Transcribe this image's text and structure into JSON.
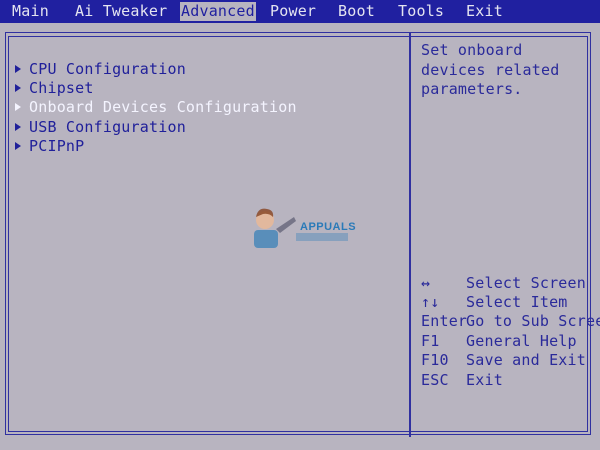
{
  "menubar": {
    "tabs": [
      {
        "label": "Main"
      },
      {
        "label": "Ai Tweaker"
      },
      {
        "label": "Advanced"
      },
      {
        "label": "Power"
      },
      {
        "label": "Boot"
      },
      {
        "label": "Tools"
      },
      {
        "label": "Exit"
      }
    ],
    "active_tab": "Advanced"
  },
  "menu_items": [
    {
      "label": "CPU Configuration"
    },
    {
      "label": "Chipset"
    },
    {
      "label": "Onboard Devices Configuration",
      "selected": true
    },
    {
      "label": "USB Configuration"
    },
    {
      "label": "PCIPnP"
    }
  ],
  "help": {
    "lines": [
      "Set onboard",
      "devices related",
      "parameters."
    ]
  },
  "keys": [
    {
      "key": "↔",
      "desc": "Select Screen"
    },
    {
      "key": "↑↓",
      "desc": "Select Item"
    },
    {
      "key": "Enter",
      "desc": "Go to Sub Screen"
    },
    {
      "key": "F1",
      "desc": "General Help"
    },
    {
      "key": "F10",
      "desc": "Save and Exit"
    },
    {
      "key": "ESC",
      "desc": "Exit"
    }
  ],
  "watermark": {
    "text": "APPUALS"
  },
  "colors": {
    "background": "#b8b4c0",
    "menubar": "#2020a0",
    "text": "#2020a0",
    "selected_text": "#f4f4ff",
    "tab_text": "#e4e4f0"
  }
}
